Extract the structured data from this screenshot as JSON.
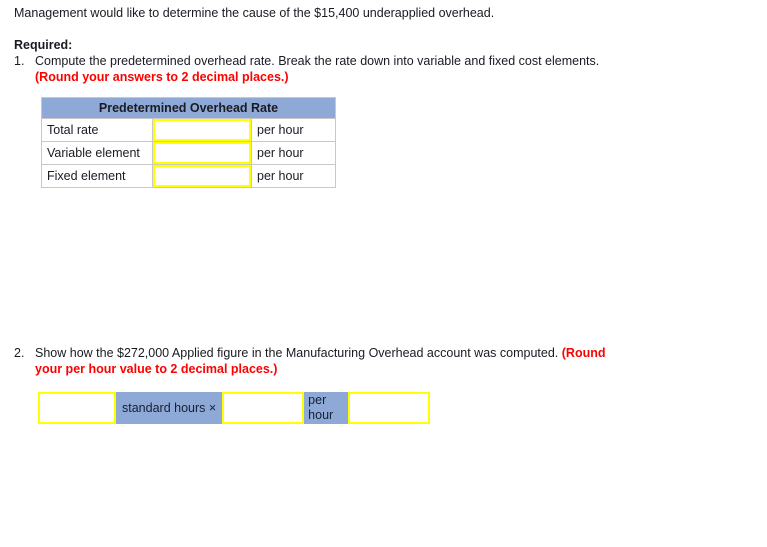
{
  "intro": {
    "text": "Management would like to determine the cause of the $15,400 underapplied overhead."
  },
  "required": {
    "label": "Required:"
  },
  "question1": {
    "number": "1.",
    "text": "Compute the predetermined overhead rate. Break the rate down into variable and fixed cost elements.",
    "note": "(Round your answers to 2 decimal places.)"
  },
  "rate_table": {
    "header": "Predetermined Overhead Rate",
    "rows": [
      {
        "label": "Total rate",
        "value": "",
        "unit": "per hour"
      },
      {
        "label": "Variable element",
        "value": "",
        "unit": "per hour"
      },
      {
        "label": "Fixed element",
        "value": "",
        "unit": "per hour"
      }
    ]
  },
  "question2": {
    "number": "2.",
    "text": "Show how the $272,000 Applied figure in the Manufacturing Overhead account was computed.",
    "note_part1": "(Round",
    "note_part2": "your per hour value to 2 decimal places.)"
  },
  "formula": {
    "input1": "",
    "operator_label": "standard hours ×",
    "input2": "",
    "unit_label": "per hour",
    "input3": ""
  },
  "colors": {
    "header_blue": "#8ea9d6",
    "input_border_yellow": "#ffff00",
    "note_red": "#ff0000",
    "table_border_gray": "#c8c8c8"
  }
}
